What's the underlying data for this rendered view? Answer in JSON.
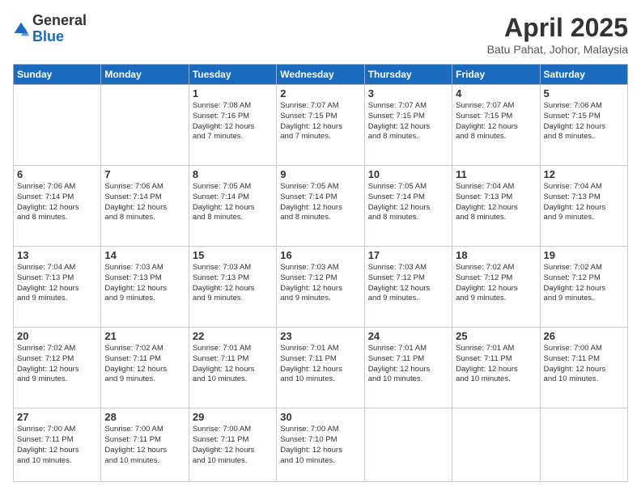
{
  "logo": {
    "general": "General",
    "blue": "Blue"
  },
  "header": {
    "month": "April 2025",
    "location": "Batu Pahat, Johor, Malaysia"
  },
  "days_of_week": [
    "Sunday",
    "Monday",
    "Tuesday",
    "Wednesday",
    "Thursday",
    "Friday",
    "Saturday"
  ],
  "weeks": [
    [
      {
        "day": "",
        "info": ""
      },
      {
        "day": "",
        "info": ""
      },
      {
        "day": "1",
        "info": "Sunrise: 7:08 AM\nSunset: 7:16 PM\nDaylight: 12 hours\nand 7 minutes."
      },
      {
        "day": "2",
        "info": "Sunrise: 7:07 AM\nSunset: 7:15 PM\nDaylight: 12 hours\nand 7 minutes."
      },
      {
        "day": "3",
        "info": "Sunrise: 7:07 AM\nSunset: 7:15 PM\nDaylight: 12 hours\nand 8 minutes."
      },
      {
        "day": "4",
        "info": "Sunrise: 7:07 AM\nSunset: 7:15 PM\nDaylight: 12 hours\nand 8 minutes."
      },
      {
        "day": "5",
        "info": "Sunrise: 7:06 AM\nSunset: 7:15 PM\nDaylight: 12 hours\nand 8 minutes."
      }
    ],
    [
      {
        "day": "6",
        "info": "Sunrise: 7:06 AM\nSunset: 7:14 PM\nDaylight: 12 hours\nand 8 minutes."
      },
      {
        "day": "7",
        "info": "Sunrise: 7:06 AM\nSunset: 7:14 PM\nDaylight: 12 hours\nand 8 minutes."
      },
      {
        "day": "8",
        "info": "Sunrise: 7:05 AM\nSunset: 7:14 PM\nDaylight: 12 hours\nand 8 minutes."
      },
      {
        "day": "9",
        "info": "Sunrise: 7:05 AM\nSunset: 7:14 PM\nDaylight: 12 hours\nand 8 minutes."
      },
      {
        "day": "10",
        "info": "Sunrise: 7:05 AM\nSunset: 7:14 PM\nDaylight: 12 hours\nand 8 minutes."
      },
      {
        "day": "11",
        "info": "Sunrise: 7:04 AM\nSunset: 7:13 PM\nDaylight: 12 hours\nand 8 minutes."
      },
      {
        "day": "12",
        "info": "Sunrise: 7:04 AM\nSunset: 7:13 PM\nDaylight: 12 hours\nand 9 minutes."
      }
    ],
    [
      {
        "day": "13",
        "info": "Sunrise: 7:04 AM\nSunset: 7:13 PM\nDaylight: 12 hours\nand 9 minutes."
      },
      {
        "day": "14",
        "info": "Sunrise: 7:03 AM\nSunset: 7:13 PM\nDaylight: 12 hours\nand 9 minutes."
      },
      {
        "day": "15",
        "info": "Sunrise: 7:03 AM\nSunset: 7:13 PM\nDaylight: 12 hours\nand 9 minutes."
      },
      {
        "day": "16",
        "info": "Sunrise: 7:03 AM\nSunset: 7:12 PM\nDaylight: 12 hours\nand 9 minutes."
      },
      {
        "day": "17",
        "info": "Sunrise: 7:03 AM\nSunset: 7:12 PM\nDaylight: 12 hours\nand 9 minutes."
      },
      {
        "day": "18",
        "info": "Sunrise: 7:02 AM\nSunset: 7:12 PM\nDaylight: 12 hours\nand 9 minutes."
      },
      {
        "day": "19",
        "info": "Sunrise: 7:02 AM\nSunset: 7:12 PM\nDaylight: 12 hours\nand 9 minutes."
      }
    ],
    [
      {
        "day": "20",
        "info": "Sunrise: 7:02 AM\nSunset: 7:12 PM\nDaylight: 12 hours\nand 9 minutes."
      },
      {
        "day": "21",
        "info": "Sunrise: 7:02 AM\nSunset: 7:11 PM\nDaylight: 12 hours\nand 9 minutes."
      },
      {
        "day": "22",
        "info": "Sunrise: 7:01 AM\nSunset: 7:11 PM\nDaylight: 12 hours\nand 10 minutes."
      },
      {
        "day": "23",
        "info": "Sunrise: 7:01 AM\nSunset: 7:11 PM\nDaylight: 12 hours\nand 10 minutes."
      },
      {
        "day": "24",
        "info": "Sunrise: 7:01 AM\nSunset: 7:11 PM\nDaylight: 12 hours\nand 10 minutes."
      },
      {
        "day": "25",
        "info": "Sunrise: 7:01 AM\nSunset: 7:11 PM\nDaylight: 12 hours\nand 10 minutes."
      },
      {
        "day": "26",
        "info": "Sunrise: 7:00 AM\nSunset: 7:11 PM\nDaylight: 12 hours\nand 10 minutes."
      }
    ],
    [
      {
        "day": "27",
        "info": "Sunrise: 7:00 AM\nSunset: 7:11 PM\nDaylight: 12 hours\nand 10 minutes."
      },
      {
        "day": "28",
        "info": "Sunrise: 7:00 AM\nSunset: 7:11 PM\nDaylight: 12 hours\nand 10 minutes."
      },
      {
        "day": "29",
        "info": "Sunrise: 7:00 AM\nSunset: 7:11 PM\nDaylight: 12 hours\nand 10 minutes."
      },
      {
        "day": "30",
        "info": "Sunrise: 7:00 AM\nSunset: 7:10 PM\nDaylight: 12 hours\nand 10 minutes."
      },
      {
        "day": "",
        "info": ""
      },
      {
        "day": "",
        "info": ""
      },
      {
        "day": "",
        "info": ""
      }
    ]
  ]
}
